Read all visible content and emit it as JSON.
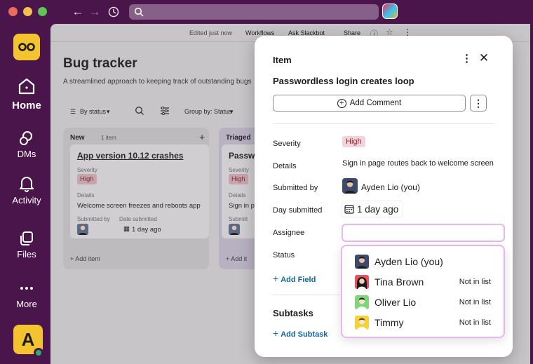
{
  "titlebar": {
    "search_placeholder": ""
  },
  "rail": {
    "items": [
      {
        "label": "Home",
        "icon": "home-icon"
      },
      {
        "label": "DMs",
        "icon": "dms-icon"
      },
      {
        "label": "Activity",
        "icon": "bell-icon"
      },
      {
        "label": "Files",
        "icon": "files-icon"
      },
      {
        "label": "More",
        "icon": "more-icon"
      }
    ],
    "user_initial": "A"
  },
  "main": {
    "header": {
      "edited": "Edited just now",
      "workflows": "Workflows",
      "ask": "Ask Slackbot",
      "share": "Share"
    },
    "title": "Bug tracker",
    "description": "A streamlined approach to keeping track of outstanding bugs",
    "toolbar": {
      "by_status": "By status",
      "group_by": "Group by: Status"
    },
    "columns": [
      {
        "title": "New",
        "count": "1 item",
        "card": {
          "title": "App version 10.12 crashes",
          "severity_label": "Severity",
          "severity": "High",
          "details_label": "Details",
          "details": "Welcome screen freezes and reboots app",
          "submitted_by_label": "Submitted by",
          "day_submitted_label": "Date submitted",
          "day_submitted": "1 day ago"
        },
        "add_item": "Add item"
      },
      {
        "title": "Triaged",
        "card": {
          "title": "Passwo",
          "severity_label": "Severity",
          "severity": "High",
          "details_label": "Details",
          "details": "Sign in pa",
          "submitted_by_label": "Submitt"
        },
        "add_item": "Add it"
      }
    ]
  },
  "modal": {
    "header": "Item",
    "title": "Passwordless login creates loop",
    "add_comment": "Add Comment",
    "fields": {
      "severity_label": "Severity",
      "severity": "High",
      "details_label": "Details",
      "details": "Sign in page routes back to welcome screen",
      "submitted_by_label": "Submitted by",
      "submitted_by": "Ayden Lio (you)",
      "day_submitted_label": "Day submitted",
      "day_submitted": "1 day ago",
      "assignee_label": "Assignee",
      "status_label": "Status"
    },
    "add_field": "Add Field",
    "subtasks_title": "Subtasks",
    "add_subtask": "Add Subtask"
  },
  "dropdown": {
    "options": [
      {
        "name": "Ayden Lio (you)",
        "note": ""
      },
      {
        "name": "Tina Brown",
        "note": "Not in list"
      },
      {
        "name": "Oliver Lio",
        "note": "Not in list"
      },
      {
        "name": "Timmy",
        "note": "Not in list"
      }
    ]
  },
  "colors": {
    "sidebar": "#4a154b",
    "accent_pink": "#e7b6ef",
    "badge_bg": "#f4d3da",
    "badge_text": "#8a2138",
    "link": "#1264a3",
    "workspace_yellow": "#f4c430"
  }
}
